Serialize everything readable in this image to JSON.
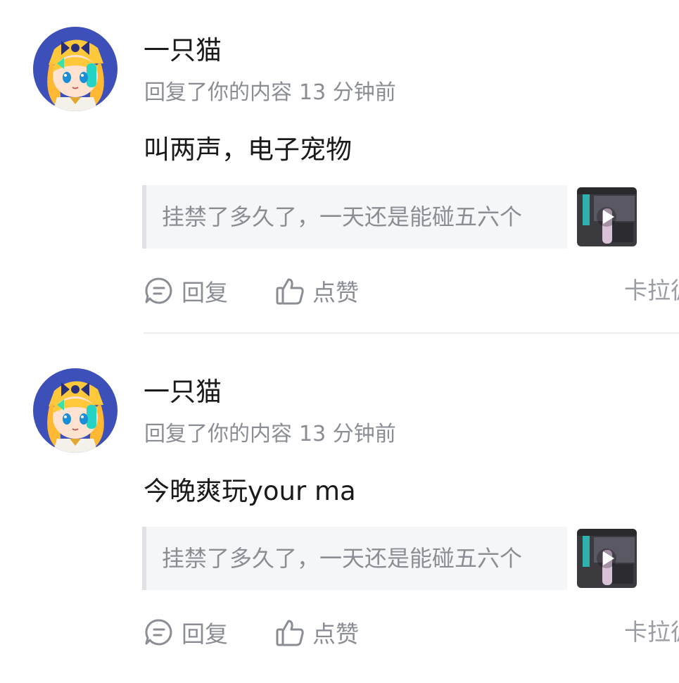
{
  "notifications": [
    {
      "username": "一只猫",
      "action_text": "回复了你的内容",
      "time": "13 分钟前",
      "reply": "叫两声，电子宠物",
      "quoted_text": "挂禁了多久了，一天还是能碰五六个",
      "reply_button": "回复",
      "like_button": "点赞",
      "source": "卡拉彼"
    },
    {
      "username": "一只猫",
      "action_text": "回复了你的内容",
      "time": "13 分钟前",
      "reply": "今晚爽玩your ma",
      "quoted_text": "挂禁了多久了，一天还是能碰五六个",
      "reply_button": "回复",
      "like_button": "点赞",
      "source": "卡拉彼"
    }
  ],
  "colors": {
    "primary_text": "#1a1a1a",
    "secondary_text": "#8a8e94",
    "quote_bg": "#f5f6f8",
    "avatar_bg": "#3d4fb8"
  },
  "icons": [
    "comment-icon",
    "thumbs-up-icon",
    "play-icon"
  ]
}
